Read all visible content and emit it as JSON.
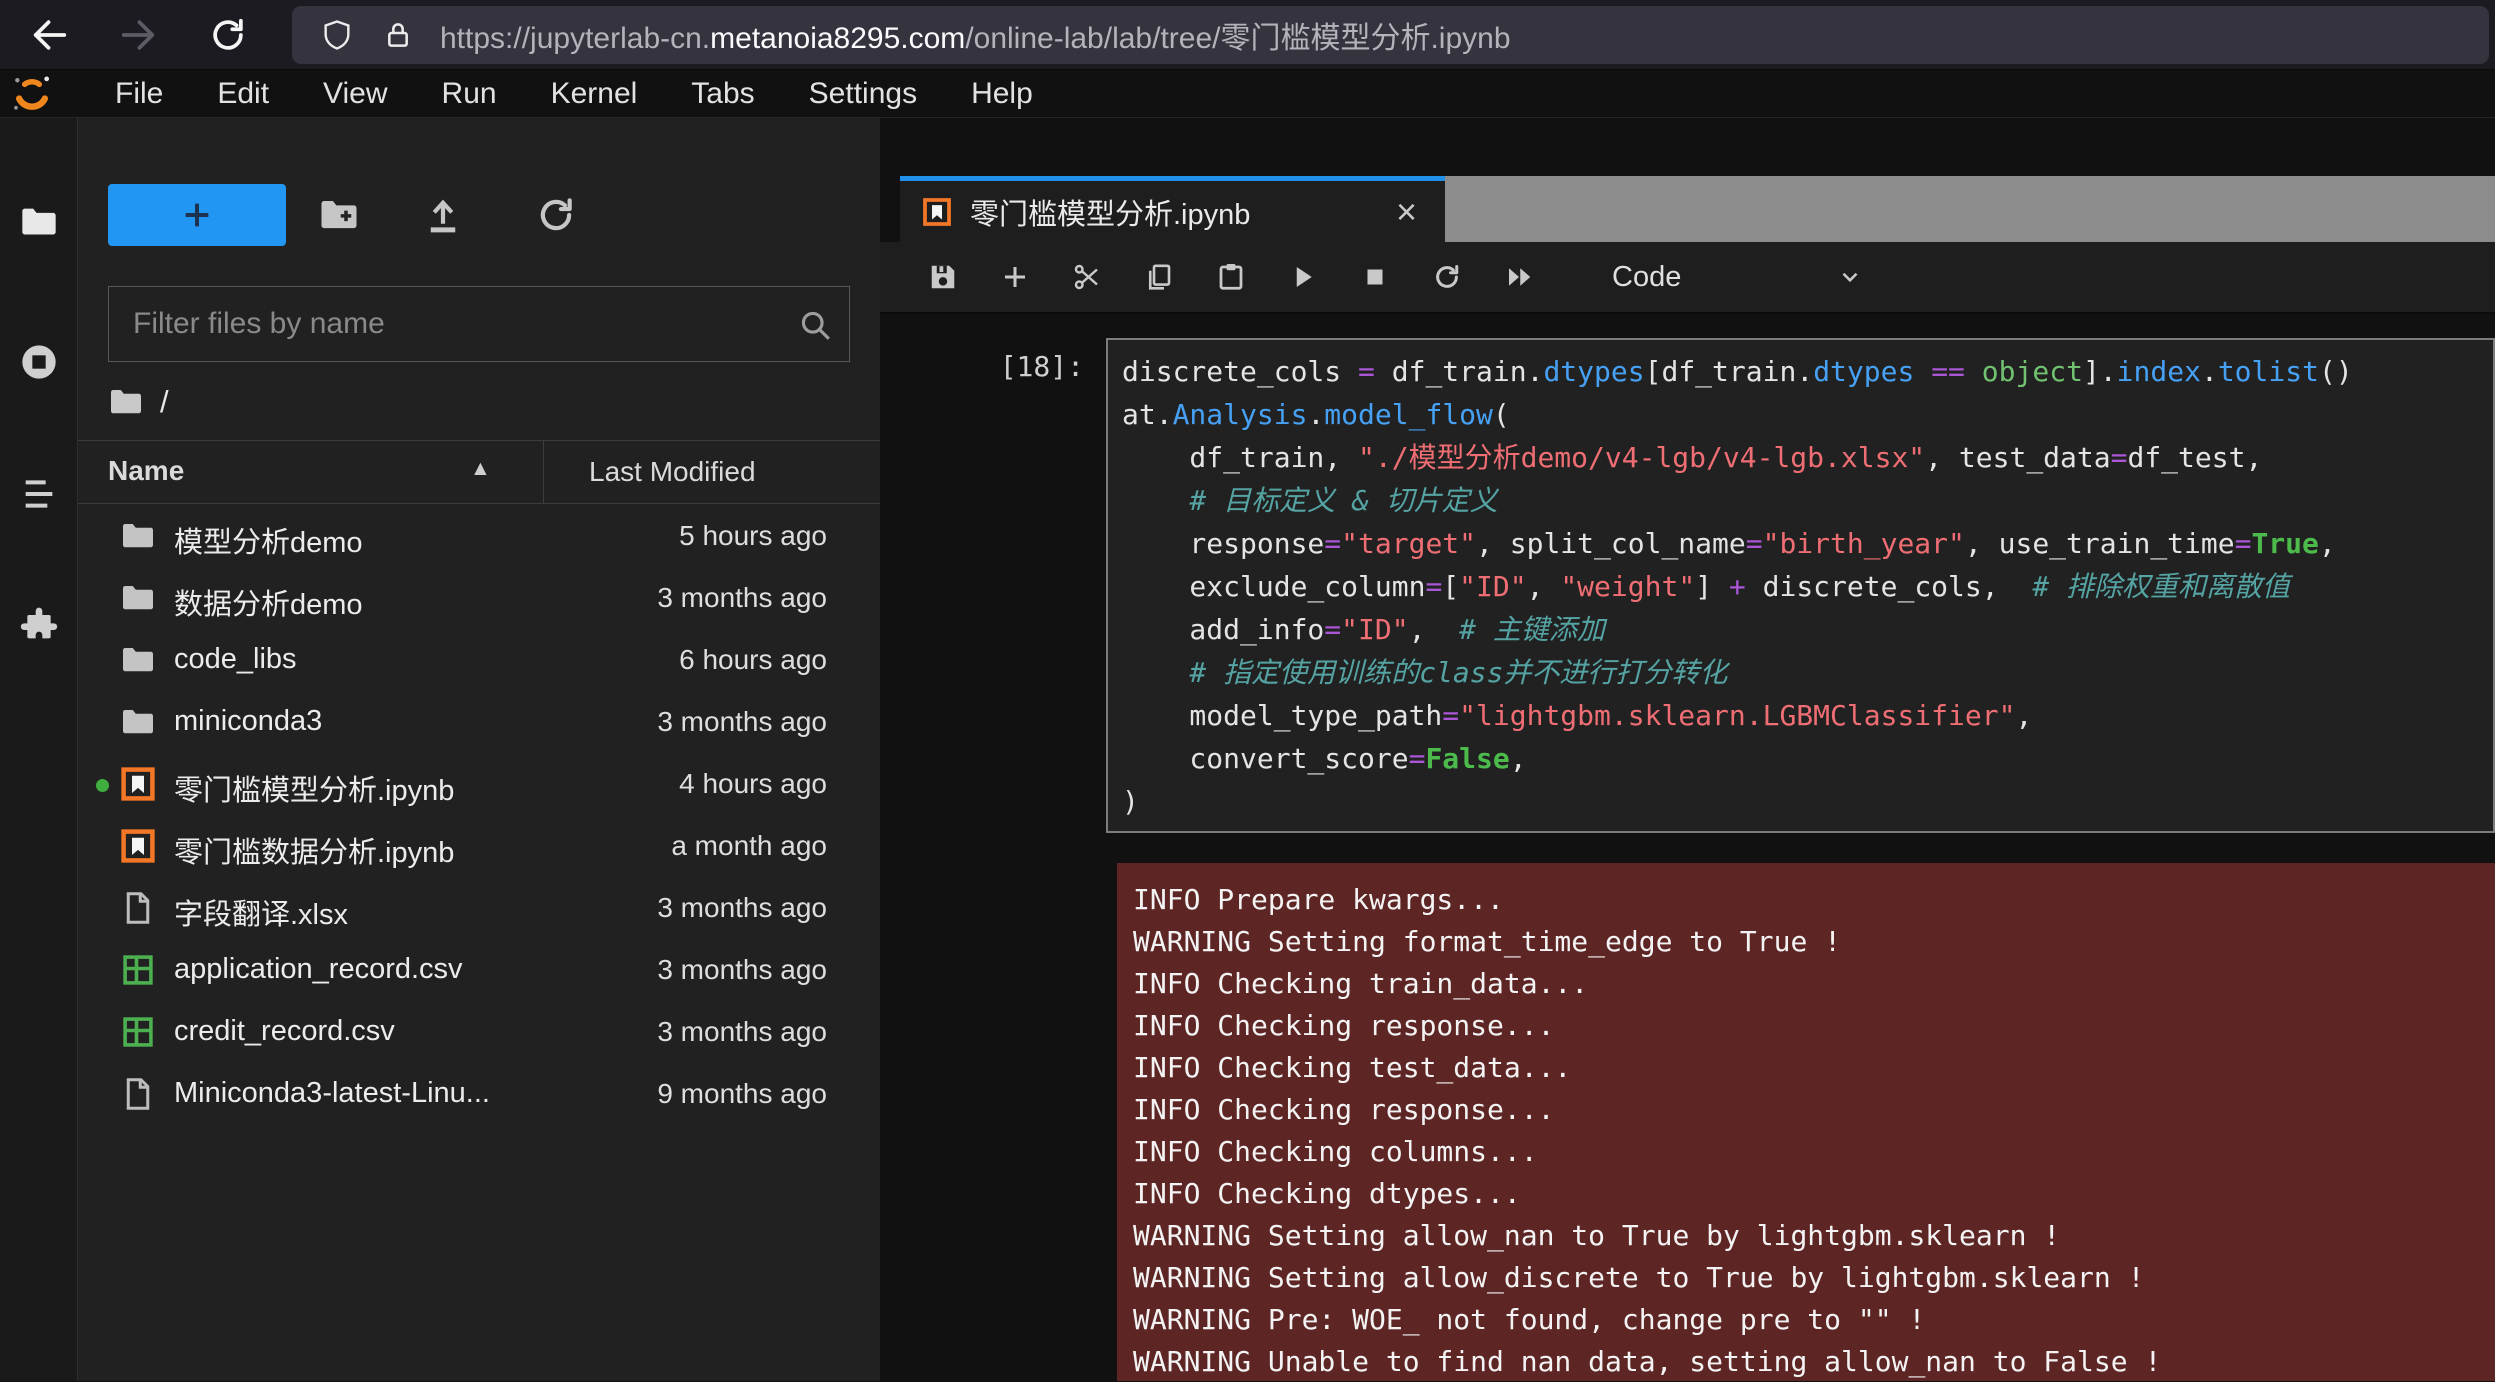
{
  "browser": {
    "url_prefix": "https://jupyterlab-cn.",
    "url_domain": "metanoia8295.com",
    "url_path": "/online-lab/lab/tree/零门槛模型分析.ipynb"
  },
  "menu": {
    "items": [
      "File",
      "Edit",
      "View",
      "Run",
      "Kernel",
      "Tabs",
      "Settings",
      "Help"
    ]
  },
  "sidebar": {
    "icons": [
      "file-browser",
      "running-sessions",
      "table-of-contents",
      "extensions"
    ]
  },
  "filebrowser": {
    "filter_placeholder": "Filter files by name",
    "breadcrumb": "/",
    "columns": {
      "name": "Name",
      "modified": "Last Modified"
    },
    "sort": "ascending",
    "files": [
      {
        "icon": "folder",
        "name": "模型分析demo",
        "modified": "5 hours ago",
        "running": false
      },
      {
        "icon": "folder",
        "name": "数据分析demo",
        "modified": "3 months ago",
        "running": false
      },
      {
        "icon": "folder",
        "name": "code_libs",
        "modified": "6 hours ago",
        "running": false
      },
      {
        "icon": "folder",
        "name": "miniconda3",
        "modified": "3 months ago",
        "running": false
      },
      {
        "icon": "notebook",
        "name": "零门槛模型分析.ipynb",
        "modified": "4 hours ago",
        "running": true
      },
      {
        "icon": "notebook",
        "name": "零门槛数据分析.ipynb",
        "modified": "a month ago",
        "running": false
      },
      {
        "icon": "file",
        "name": "字段翻译.xlsx",
        "modified": "3 months ago",
        "running": false
      },
      {
        "icon": "csv",
        "name": "application_record.csv",
        "modified": "3 months ago",
        "running": false
      },
      {
        "icon": "csv",
        "name": "credit_record.csv",
        "modified": "3 months ago",
        "running": false
      },
      {
        "icon": "file",
        "name": "Miniconda3-latest-Linu...",
        "modified": "9 months ago",
        "running": false
      }
    ]
  },
  "tab": {
    "title": "零门槛模型分析.ipynb"
  },
  "nbtoolbar": {
    "mode": "Code"
  },
  "cell": {
    "prompt": "[18]:",
    "lines": [
      [
        [
          "p",
          "discrete_cols "
        ],
        [
          "op",
          "="
        ],
        [
          "p",
          " df_train."
        ],
        [
          "prop",
          "dtypes"
        ],
        [
          "p",
          "[df_train."
        ],
        [
          "prop",
          "dtypes"
        ],
        [
          "p",
          " "
        ],
        [
          "op",
          "=="
        ],
        [
          "p",
          " "
        ],
        [
          "b",
          "object"
        ],
        [
          "p",
          "]."
        ],
        [
          "prop",
          "index"
        ],
        [
          "p",
          "."
        ],
        [
          "prop",
          "tolist"
        ],
        [
          "p",
          "()"
        ]
      ],
      [
        [
          "p",
          "at."
        ],
        [
          "prop",
          "Analysis"
        ],
        [
          "p",
          "."
        ],
        [
          "prop",
          "model_flow"
        ],
        [
          "p",
          "("
        ]
      ],
      [
        [
          "p",
          "    df_train, "
        ],
        [
          "str",
          "\"./模型分析demo/v4-lgb/v4-lgb.xlsx\""
        ],
        [
          "p",
          ", test_data"
        ],
        [
          "op",
          "="
        ],
        [
          "p",
          "df_test,"
        ]
      ],
      [
        [
          "cmt",
          "    # 目标定义 & 切片定义"
        ]
      ],
      [
        [
          "p",
          "    response"
        ],
        [
          "op",
          "="
        ],
        [
          "str",
          "\"target\""
        ],
        [
          "p",
          ", split_col_name"
        ],
        [
          "op",
          "="
        ],
        [
          "str",
          "\"birth_year\""
        ],
        [
          "p",
          ", use_train_time"
        ],
        [
          "op",
          "="
        ],
        [
          "kw",
          "True"
        ],
        [
          "p",
          ","
        ]
      ],
      [
        [
          "p",
          "    exclude_column"
        ],
        [
          "op",
          "="
        ],
        [
          "p",
          "["
        ],
        [
          "str",
          "\"ID\""
        ],
        [
          "p",
          ", "
        ],
        [
          "str",
          "\"weight\""
        ],
        [
          "p",
          "] "
        ],
        [
          "op",
          "+"
        ],
        [
          "p",
          " discrete_cols,  "
        ],
        [
          "cmt",
          "# 排除权重和离散值"
        ]
      ],
      [
        [
          "p",
          "    add_info"
        ],
        [
          "op",
          "="
        ],
        [
          "str",
          "\"ID\""
        ],
        [
          "p",
          ",  "
        ],
        [
          "cmt",
          "# 主键添加"
        ]
      ],
      [
        [
          "cmt",
          "    # 指定使用训练的class并不进行打分转化"
        ]
      ],
      [
        [
          "p",
          "    model_type_path"
        ],
        [
          "op",
          "="
        ],
        [
          "str",
          "\"lightgbm.sklearn.LGBMClassifier\""
        ],
        [
          "p",
          ","
        ]
      ],
      [
        [
          "p",
          "    convert_score"
        ],
        [
          "op",
          "="
        ],
        [
          "kw",
          "False"
        ],
        [
          "p",
          ","
        ]
      ],
      [
        [
          "p",
          ")"
        ]
      ]
    ]
  },
  "output": {
    "lines": [
      "INFO Prepare kwargs...",
      "WARNING Setting format_time_edge to True !",
      "INFO Checking train_data...",
      "INFO Checking response...",
      "INFO Checking test_data...",
      "INFO Checking response...",
      "INFO Checking columns...",
      "INFO Checking dtypes...",
      "WARNING Setting allow_nan to True by lightgbm.sklearn !",
      "WARNING Setting allow_discrete to True by lightgbm.sklearn !",
      "WARNING Pre: WOE_ not found, change pre to \"\" !",
      "WARNING Unable to find nan data, setting allow_nan to False !"
    ]
  },
  "colors": {
    "accent_blue": "#2196f3",
    "tab_active_stripe": "#2090ea",
    "jupyter_orange": "#f37726",
    "csv_green": "#4caf50",
    "running_dot_green": "#3fae3f",
    "stderr_background": "#5e2525",
    "tabbar_fill_gray": "#8c8c8c"
  }
}
